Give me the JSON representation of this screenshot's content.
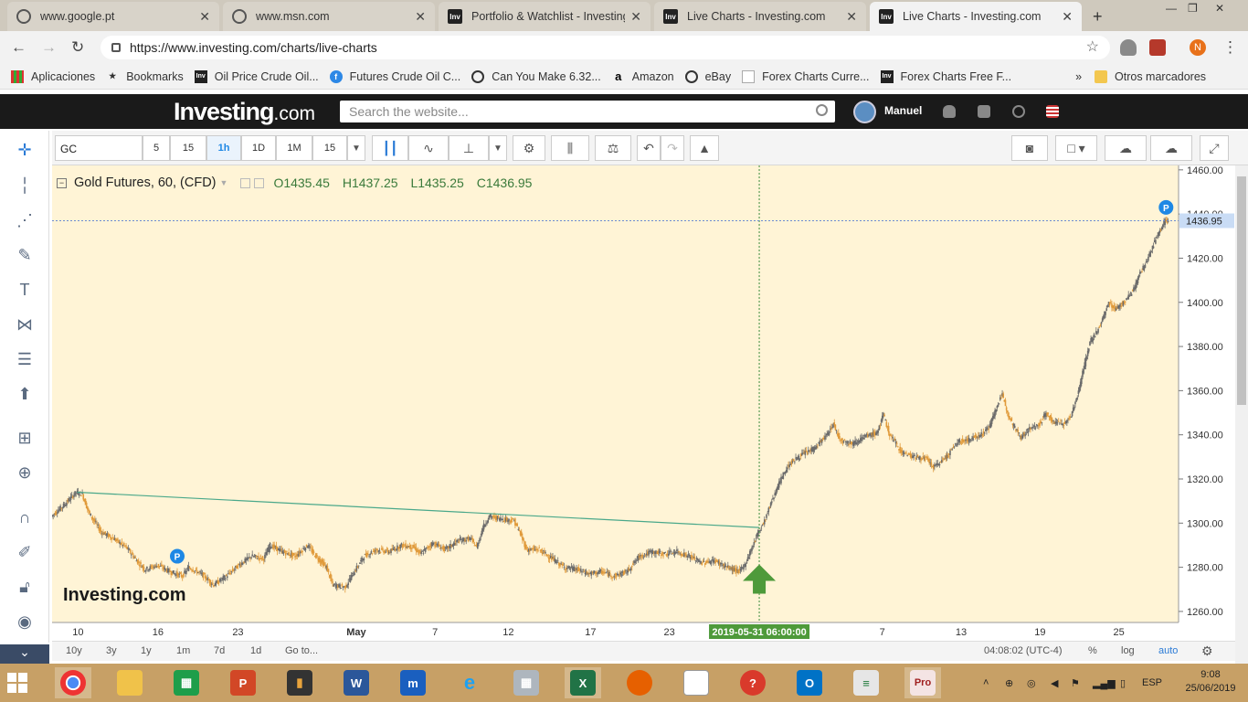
{
  "browser": {
    "tabs": [
      {
        "title": "www.google.pt",
        "icon": "globe-icon"
      },
      {
        "title": "www.msn.com",
        "icon": "globe-icon"
      },
      {
        "title": "Portfolio & Watchlist - Investing",
        "icon": "investing-favicon"
      },
      {
        "title": "Live Charts - Investing.com",
        "icon": "investing-favicon"
      },
      {
        "title": "Live Charts - Investing.com",
        "icon": "investing-favicon",
        "active": true
      }
    ],
    "url": "https://www.investing.com/charts/live-charts",
    "profile_initial": "N",
    "bookmarks": [
      {
        "label": "Aplicaciones",
        "icon": "apps-icon"
      },
      {
        "label": "Bookmarks",
        "icon": "star-icon"
      },
      {
        "label": "Oil Price  Crude Oil...",
        "icon": "investing-favicon"
      },
      {
        "label": "Futures Crude Oil C...",
        "icon": "facebook-icon"
      },
      {
        "label": "Can You Make 6.32...",
        "icon": "globe-icon"
      },
      {
        "label": "Amazon",
        "icon": "amazon-icon"
      },
      {
        "label": "eBay",
        "icon": "globe-icon"
      },
      {
        "label": "Forex Charts  Curre...",
        "icon": "page-icon"
      },
      {
        "label": "Forex Charts  Free F...",
        "icon": "investing-favicon"
      }
    ],
    "other_bookmarks": "Otros marcadores",
    "more": "»"
  },
  "site": {
    "logo_main": "Investing",
    "logo_suffix": ".com",
    "search_placeholder": "Search the website...",
    "username": "Manuel"
  },
  "toolbar": {
    "symbol": "GC",
    "timeframes": [
      "5",
      "15",
      "1h",
      "1D",
      "1M",
      "15"
    ],
    "active_timeframe": "1h"
  },
  "legend": {
    "title": "Gold Futures, 60, (CFD)",
    "open": "O1435.45",
    "high": "H1437.25",
    "low": "L1435.25",
    "close": "C1436.95"
  },
  "chart_data": {
    "type": "candlestick",
    "instrument": "Gold Futures",
    "interval": "60",
    "y_ticks": [
      1260,
      1280,
      1300,
      1320,
      1340,
      1360,
      1380,
      1400,
      1420,
      1440,
      1460
    ],
    "ylim": [
      1255,
      1462
    ],
    "x_ticks": [
      "10",
      "16",
      "23",
      "May",
      "7",
      "12",
      "17",
      "23",
      "7",
      "13",
      "19",
      "25"
    ],
    "last_price": "1436.95",
    "crosshair_time": "2019-05-31 06:00:00",
    "watermark": "Investing.com",
    "price_path": [
      [
        0,
        1303
      ],
      [
        2,
        1308
      ],
      [
        4,
        1314
      ],
      [
        5,
        1313
      ],
      [
        6,
        1305
      ],
      [
        8,
        1296
      ],
      [
        10,
        1293
      ],
      [
        12,
        1289
      ],
      [
        14,
        1282
      ],
      [
        15,
        1279
      ],
      [
        17,
        1281
      ],
      [
        19,
        1278
      ],
      [
        21,
        1276
      ],
      [
        22,
        1280
      ],
      [
        24,
        1277
      ],
      [
        26,
        1272
      ],
      [
        28,
        1276
      ],
      [
        30,
        1281
      ],
      [
        32,
        1285
      ],
      [
        34,
        1284
      ],
      [
        35,
        1290
      ],
      [
        37,
        1287
      ],
      [
        39,
        1285
      ],
      [
        41,
        1290
      ],
      [
        42,
        1286
      ],
      [
        44,
        1280
      ],
      [
        45,
        1272
      ],
      [
        47,
        1271
      ],
      [
        48,
        1276
      ],
      [
        50,
        1285
      ],
      [
        52,
        1288
      ],
      [
        54,
        1287
      ],
      [
        56,
        1290
      ],
      [
        58,
        1289
      ],
      [
        59,
        1286
      ],
      [
        61,
        1291
      ],
      [
        63,
        1288
      ],
      [
        65,
        1292
      ],
      [
        67,
        1293
      ],
      [
        68,
        1289
      ],
      [
        69,
        1298
      ],
      [
        70,
        1303
      ],
      [
        72,
        1302
      ],
      [
        74,
        1301
      ],
      [
        75,
        1295
      ],
      [
        76,
        1288
      ],
      [
        78,
        1288
      ],
      [
        80,
        1284
      ],
      [
        82,
        1280
      ],
      [
        84,
        1279
      ],
      [
        86,
        1277
      ],
      [
        88,
        1278
      ],
      [
        90,
        1276
      ],
      [
        92,
        1278
      ],
      [
        94,
        1285
      ],
      [
        96,
        1287
      ],
      [
        98,
        1286
      ],
      [
        100,
        1287
      ],
      [
        102,
        1285
      ],
      [
        104,
        1282
      ],
      [
        106,
        1283
      ],
      [
        108,
        1280
      ],
      [
        110,
        1278
      ],
      [
        111,
        1282
      ],
      [
        112,
        1289
      ],
      [
        113,
        1296
      ],
      [
        114,
        1301
      ],
      [
        115,
        1309
      ],
      [
        116,
        1316
      ],
      [
        117,
        1322
      ],
      [
        118,
        1327
      ],
      [
        119,
        1329
      ],
      [
        120,
        1331
      ],
      [
        122,
        1334
      ],
      [
        124,
        1340
      ],
      [
        125,
        1345
      ],
      [
        126,
        1338
      ],
      [
        128,
        1336
      ],
      [
        130,
        1339
      ],
      [
        132,
        1341
      ],
      [
        133,
        1349
      ],
      [
        134,
        1340
      ],
      [
        136,
        1332
      ],
      [
        138,
        1330
      ],
      [
        140,
        1329
      ],
      [
        141,
        1325
      ],
      [
        143,
        1330
      ],
      [
        145,
        1337
      ],
      [
        147,
        1338
      ],
      [
        149,
        1341
      ],
      [
        150,
        1344
      ],
      [
        151,
        1352
      ],
      [
        152,
        1358
      ],
      [
        153,
        1349
      ],
      [
        154,
        1343
      ],
      [
        155,
        1339
      ],
      [
        156,
        1342
      ],
      [
        158,
        1345
      ],
      [
        159,
        1350
      ],
      [
        160,
        1346
      ],
      [
        162,
        1345
      ],
      [
        163,
        1349
      ],
      [
        164,
        1358
      ],
      [
        165,
        1370
      ],
      [
        166,
        1382
      ],
      [
        167,
        1386
      ],
      [
        168,
        1392
      ],
      [
        169,
        1400
      ],
      [
        170,
        1397
      ],
      [
        171,
        1399
      ],
      [
        172,
        1402
      ],
      [
        173,
        1406
      ],
      [
        174,
        1413
      ],
      [
        175,
        1418
      ],
      [
        176,
        1425
      ],
      [
        177,
        1432
      ],
      [
        178,
        1437
      ],
      [
        178.5,
        1436.95
      ]
    ],
    "x_domain": [
      0,
      180
    ],
    "trendline": [
      [
        4,
        1314
      ],
      [
        113,
        1298
      ]
    ],
    "markers": [
      {
        "label": "P",
        "x": 20,
        "y": 1285
      },
      {
        "label": "P",
        "x": 178,
        "y": 1443
      }
    ],
    "arrow_x": 113
  },
  "bottombar": {
    "ranges": [
      "10y",
      "3y",
      "1y",
      "1m",
      "7d",
      "1d",
      "Go to..."
    ],
    "time": "04:08:02 (UTC-4)",
    "pct": "%",
    "log": "log",
    "auto": "auto"
  },
  "taskbar": {
    "lang": "ESP",
    "time": "9:08",
    "date": "25/06/2019"
  }
}
